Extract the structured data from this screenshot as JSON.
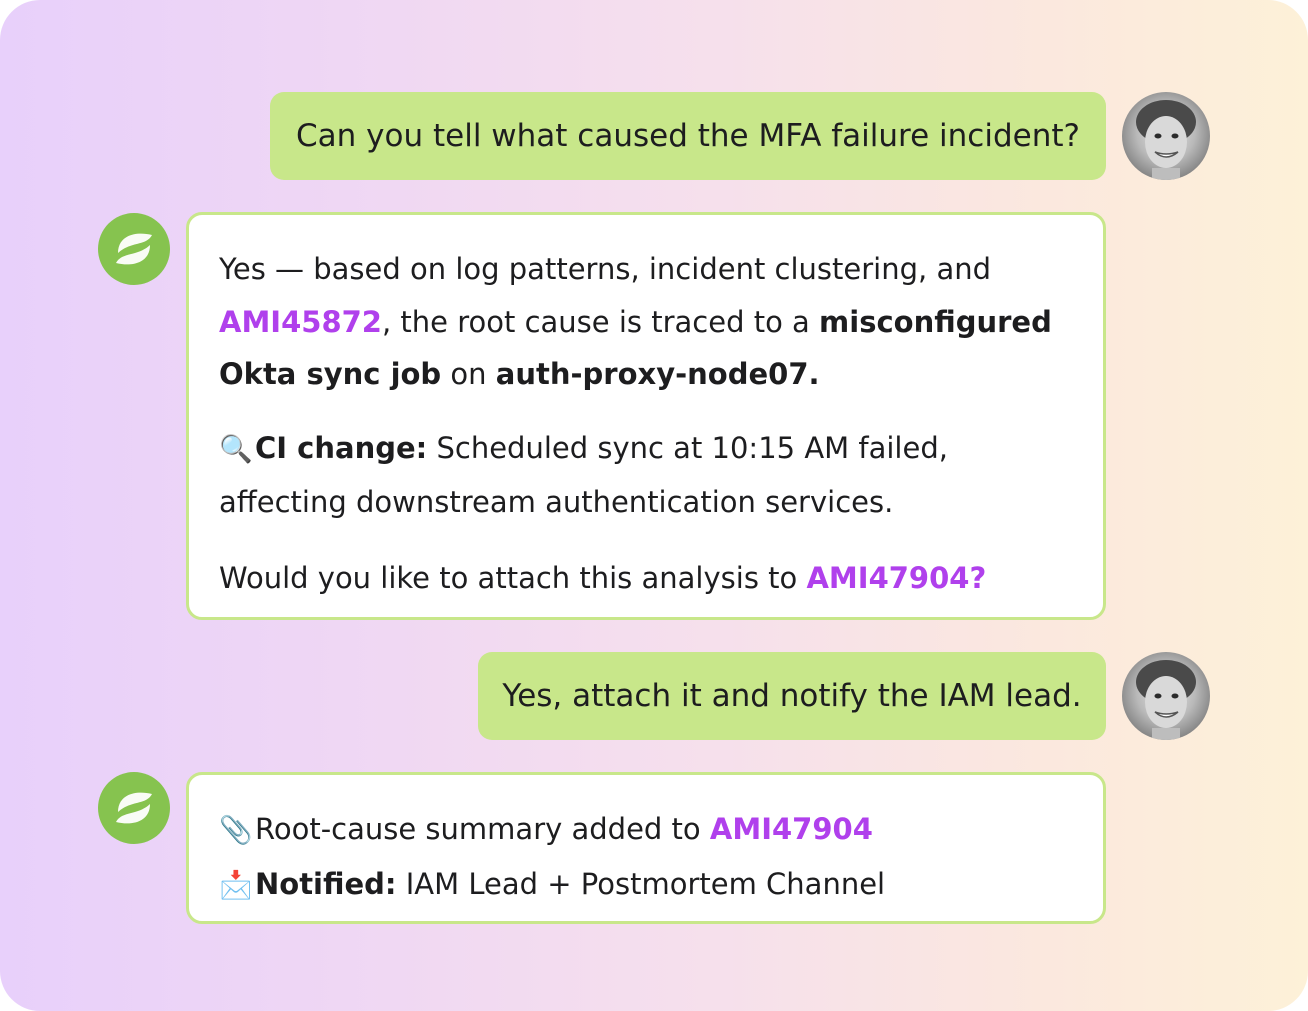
{
  "messages": {
    "user_1": {
      "text": "Can you tell what caused the MFA failure incident?"
    },
    "bot_1": {
      "p1_a": "Yes — based on log patterns, incident clustering, and",
      "p1_link": "AMI45872",
      "p1_b": ", the root cause is traced to a ",
      "p1_bold1": "misconfigured Okta sync job",
      "p1_c": " on ",
      "p1_bold2": "auth-proxy-node07.",
      "p2_icon": "🔍",
      "p2_label": "CI change:",
      "p2_text": " Scheduled sync at 10:15 AM failed, affecting downstream authentication services.",
      "p3_text": "Would you like to attach this analysis to ",
      "p3_link": "AMI47904?"
    },
    "user_2": {
      "text": "Yes, attach it and notify the IAM lead."
    },
    "bot_2": {
      "l1_icon": "📎",
      "l1_text": "Root-cause summary added to ",
      "l1_link": "AMI47904",
      "l2_icon": "📩",
      "l2_label": "Notified:",
      "l2_text": " IAM Lead + Postmortem Channel"
    }
  },
  "icons": {
    "user_avatar": "user-avatar",
    "bot_logo": "bot-logo-icon",
    "search": "magnifier-icon",
    "attachment": "paperclip-icon",
    "envelope": "envelope-icon"
  },
  "colors": {
    "user_bubble": "#c8e78a",
    "bot_border": "#c8e78a",
    "bot_logo": "#86c34f",
    "link": "#b040ec",
    "background_start": "#e8d0fb",
    "background_end": "#fdf1d8"
  }
}
